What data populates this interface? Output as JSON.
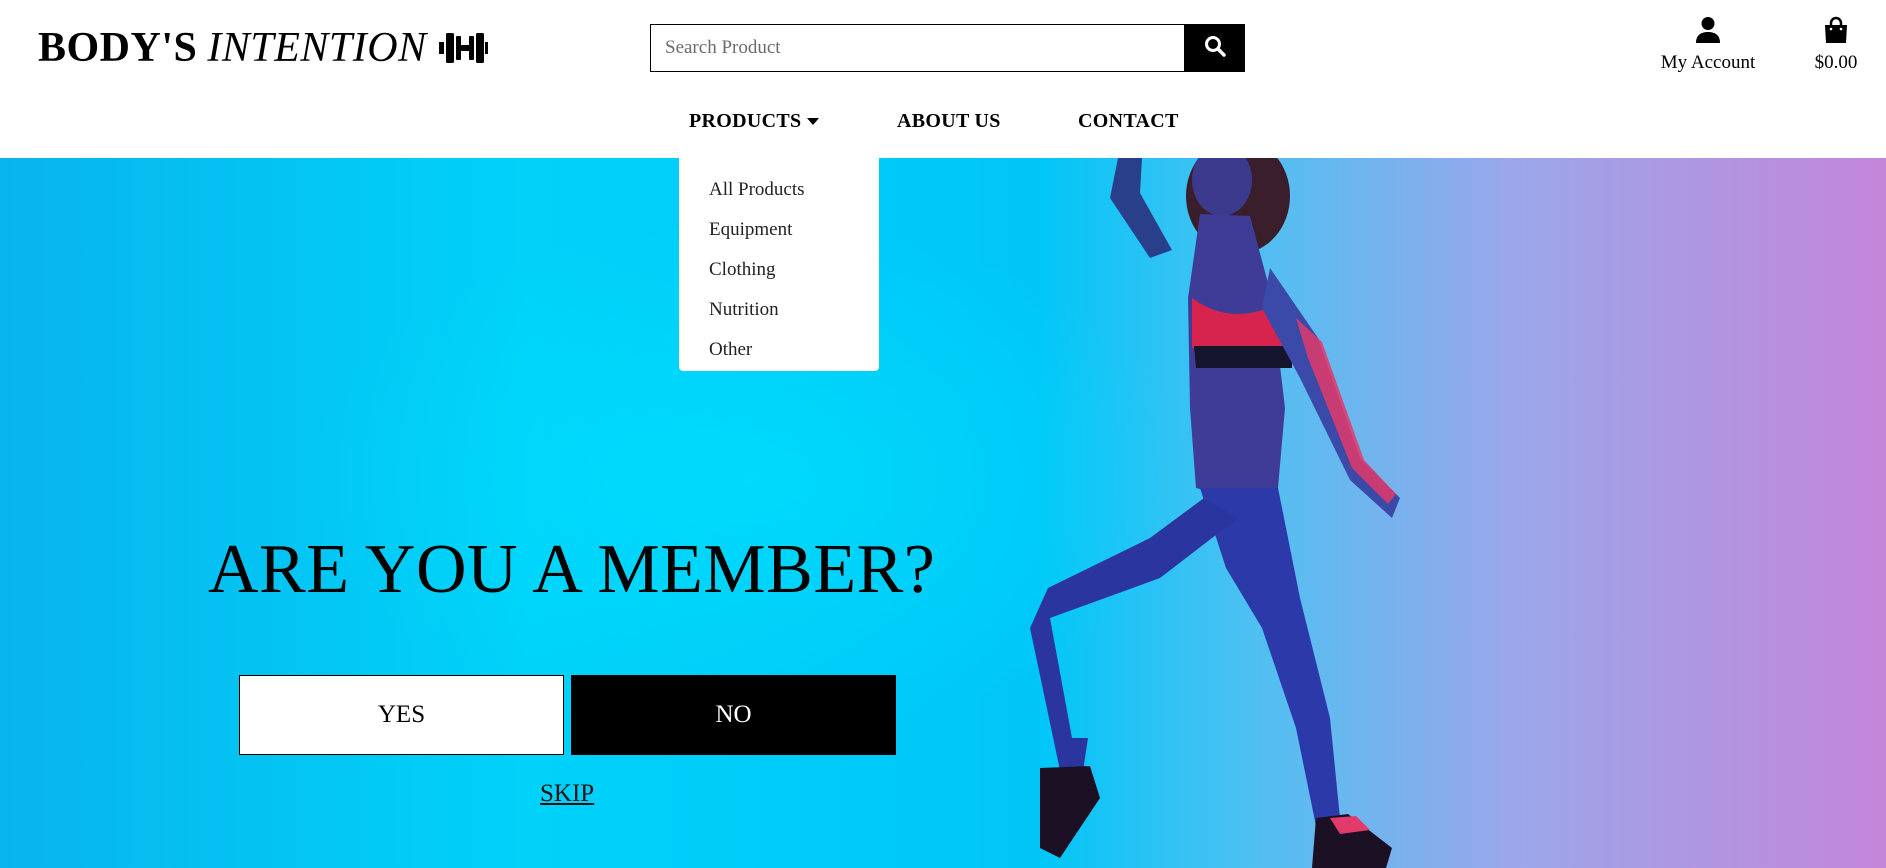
{
  "logo": {
    "bold_text": "BODY'S",
    "italic_text": "INTENTION",
    "icon": "dumbbell-icon"
  },
  "search": {
    "placeholder": "Search Product",
    "value": "",
    "button_icon": "search-icon"
  },
  "account": {
    "label": "My Account",
    "icon": "user-icon"
  },
  "cart": {
    "total": "$0.00",
    "icon": "shopping-bag-icon"
  },
  "nav": {
    "products": {
      "label": "PRODUCTS",
      "icon": "caret-down-icon"
    },
    "about": "ABOUT US",
    "contact": "CONTACT"
  },
  "dropdown": {
    "items": [
      {
        "label": "All Products"
      },
      {
        "label": "Equipment"
      },
      {
        "label": "Clothing"
      },
      {
        "label": "Nutrition"
      },
      {
        "label": "Other"
      }
    ]
  },
  "hero": {
    "title": "ARE YOU A MEMBER?",
    "yes_label": "YES",
    "no_label": "NO",
    "skip_label": "SKIP"
  },
  "colors": {
    "hero_left": "#00d2fa",
    "hero_right": "#c486da",
    "button_dark": "#000000",
    "button_light": "#ffffff"
  }
}
